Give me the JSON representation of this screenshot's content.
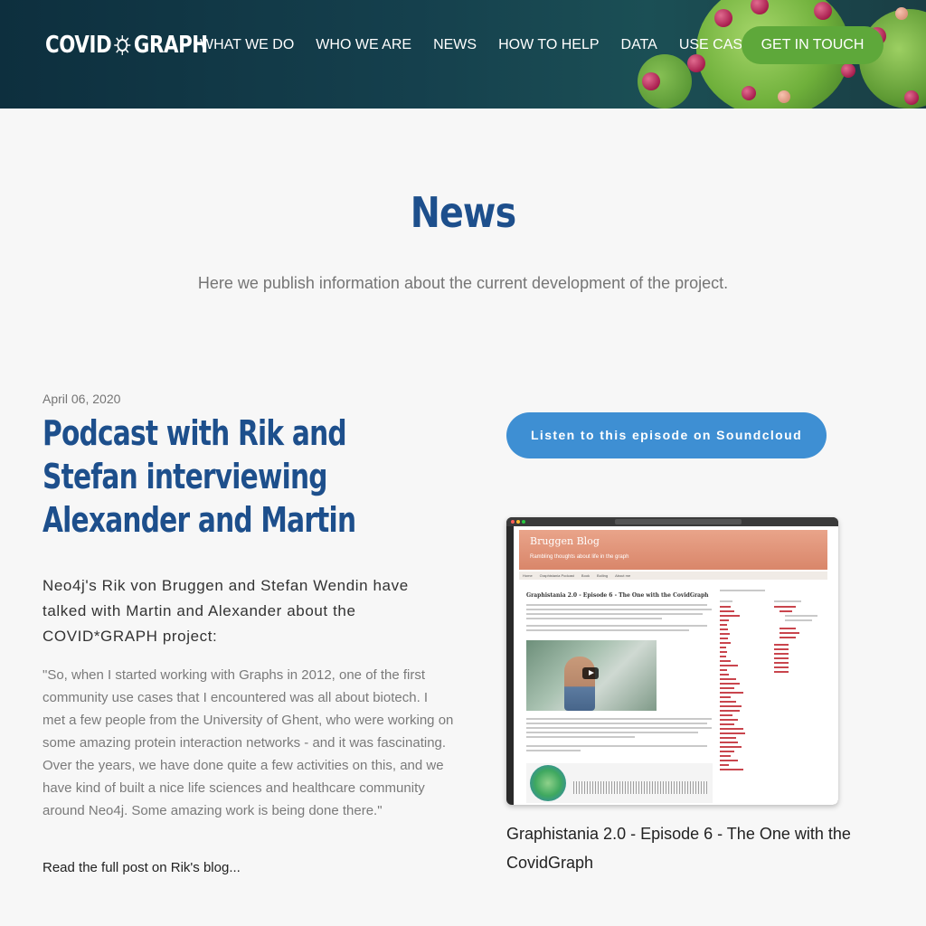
{
  "header": {
    "logo_left": "COVID",
    "logo_right": "GRAPH",
    "nav": [
      "WHAT WE DO",
      "WHO WE ARE",
      "NEWS",
      "HOW TO HELP",
      "DATA",
      "USE CASES"
    ],
    "cta_label": "GET IN TOUCH"
  },
  "hero": {
    "title": "News",
    "subtitle": "Here we publish information about the current development of the project."
  },
  "post": {
    "date": "April 06, 2020",
    "title": "Podcast with Rik and Stefan interviewing Alexander and Martin",
    "lead": "Neo4j's Rik von Bruggen and Stefan Wendin have talked with Martin and Alexander about the COVID*GRAPH project:",
    "quote": "\"So, when I started working with Graphs in 2012, one of the first community use cases that I encountered was all about biotech. I met a few people from the University of Ghent, who were working on some amazing protein interaction networks - and it was fascinating. Over the years, we have done quite a few activities on this, and we have kind of built a nice life sciences and healthcare community around Neo4j. Some amazing work is being done there.\"",
    "read_more": "Read the full post on Rik's blog...",
    "listen_label": "Listen to this episode on Soundcloud",
    "screenshot": {
      "blog_title": "Bruggen Blog",
      "blog_subtitle": "Rambling thoughts about life in the graph",
      "tabs": [
        "Home",
        "Graphistania Podcast",
        "Book",
        "Boiling",
        "About me"
      ],
      "post_title": "Graphistania 2.0 - Episode 6 - The One with the CovidGraph"
    },
    "caption": "Graphistania 2.0 - Episode 6 - The One with the CovidGraph"
  },
  "colors": {
    "brand_blue": "#1d4f8c",
    "cta_green": "#5ea83a",
    "button_blue": "#3e8fd3"
  }
}
